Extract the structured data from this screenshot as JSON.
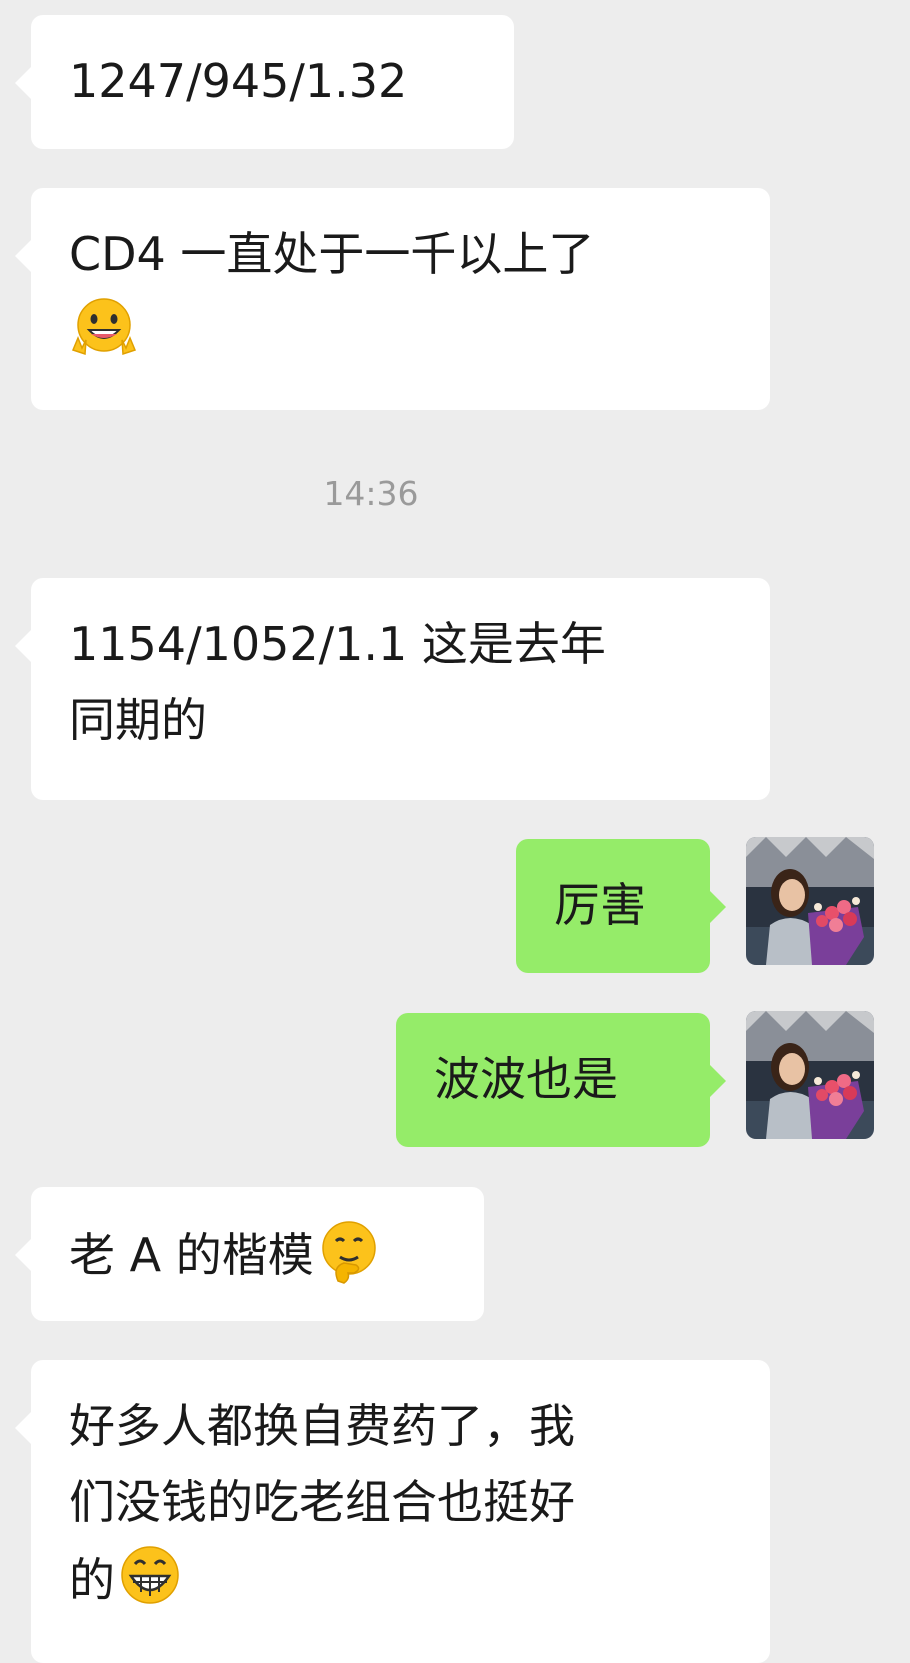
{
  "messages": [
    {
      "side": "in",
      "text": "1247/945/1.32"
    },
    {
      "side": "in",
      "text": "CD4 一直处于一千以上了",
      "emoji": "grinning-peace-emoji"
    },
    {
      "side": "in",
      "text": "1154/1052/1.1 这是去年\n同期的"
    },
    {
      "side": "out",
      "text": "厉害"
    },
    {
      "side": "out",
      "text": "波波也是"
    },
    {
      "side": "in",
      "text": "老 A 的楷模",
      "emoji": "thinking-face-emoji"
    },
    {
      "side": "in",
      "text": "好多人都换自费药了，我\n们没钱的吃老组合也挺好\n的",
      "emoji": "grinning-teeth-emoji"
    }
  ],
  "timestamp": "14:36",
  "colors": {
    "background": "#ededed",
    "incoming_bubble": "#ffffff",
    "outgoing_bubble": "#95ec69",
    "timestamp_text": "#9a9a9a"
  },
  "avatar": {
    "icon": "user-avatar-photo"
  }
}
